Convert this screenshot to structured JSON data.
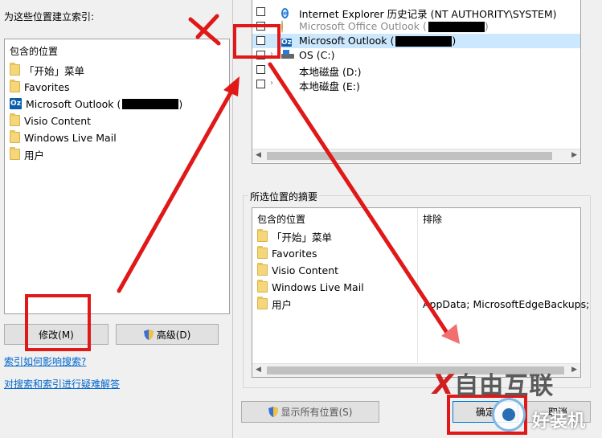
{
  "left_window": {
    "title": "为这些位置建立索引:",
    "list_header": "包含的位置",
    "items": [
      {
        "icon": "folder-icon",
        "label": "「开始」菜单"
      },
      {
        "icon": "folder-icon",
        "label": "Favorites"
      },
      {
        "icon": "outlook-icon",
        "label": "Microsoft Outlook ("
      },
      {
        "icon": "folder-icon",
        "label": "Visio Content"
      },
      {
        "icon": "folder-icon",
        "label": "Windows Live Mail"
      },
      {
        "icon": "folder-icon",
        "label": "用户"
      }
    ],
    "modify_button": "修改(M)",
    "advanced_button": "高级(D)",
    "link_how_index": "索引如何影响搜索?",
    "link_troubleshoot": "对搜索和索引进行疑难解答"
  },
  "dialog": {
    "tree_items": [
      {
        "icon": "ie-icon",
        "label": "Internet Explorer 历史记录 (NT AUTHORITY\\SYSTEM)",
        "dim": false,
        "expandable": false,
        "checked": false
      },
      {
        "icon": "envelope-icon",
        "label": "Microsoft Office Outlook (",
        "dim": true,
        "expandable": false,
        "checked": false
      },
      {
        "icon": "outlook-icon",
        "label": "Microsoft Outlook (",
        "dim": false,
        "expandable": false,
        "checked": false,
        "selected": true
      },
      {
        "icon": "os-icon",
        "label": "OS (C:)",
        "dim": false,
        "expandable": true,
        "checked": false
      },
      {
        "icon": "drive-icon",
        "label": "本地磁盘 (D:)",
        "dim": false,
        "expandable": false,
        "checked": false
      },
      {
        "icon": "drive-icon",
        "label": "本地磁盘 (E:)",
        "dim": false,
        "expandable": true,
        "checked": false
      }
    ],
    "summary_title": "所选位置的摘要",
    "summary_col_included": "包含的位置",
    "summary_col_excluded": "排除",
    "summary_items": [
      {
        "label": "「开始」菜单",
        "excluded": ""
      },
      {
        "label": "Favorites",
        "excluded": ""
      },
      {
        "label": "Visio Content",
        "excluded": ""
      },
      {
        "label": "Windows Live Mail",
        "excluded": ""
      },
      {
        "label": "用户",
        "excluded": "AppData; MicrosoftEdgeBackups;"
      }
    ],
    "show_all_button": "显示所有位置(S)",
    "ok_button": "确定",
    "cancel_button": "取消"
  },
  "watermark": {
    "brand": "自由互联",
    "site": "好装机"
  },
  "colors": {
    "annotation_red": "#e01818",
    "selection_blue": "#cce8ff",
    "link_blue": "#0066cc"
  }
}
